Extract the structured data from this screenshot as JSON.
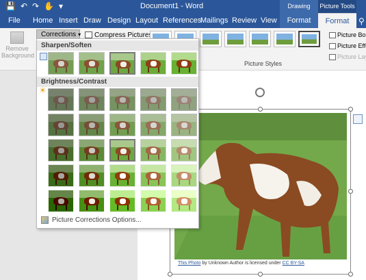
{
  "window": {
    "title": "Document1 - Word",
    "contextual_groups": [
      "Drawing Tools",
      "Picture Tools"
    ]
  },
  "tabs": [
    "File",
    "Home",
    "Insert",
    "Draw",
    "Design",
    "Layout",
    "References",
    "Mailings",
    "Review",
    "View",
    "Format",
    "Format"
  ],
  "ribbon": {
    "remove_background": "Remove Background",
    "corrections_label": "Corrections",
    "compress_label": "Compress Pictures",
    "picture_styles_label": "Picture Styles",
    "right_commands": [
      "Picture Bord",
      "Picture Effe",
      "Picture Layo"
    ]
  },
  "dropdown": {
    "section1_title": "Sharpen/Soften",
    "section2_title": "Brightness/Contrast",
    "options_link": "Picture Corrections Options...",
    "sharpen_selected_index": 2,
    "brightness_selected": [
      2,
      2
    ]
  },
  "document": {
    "caption_link1": "This Photo",
    "caption_mid": " by Unknown Author is licensed under ",
    "caption_link2": "CC BY-SA"
  },
  "colors": {
    "accent": "#2b579a",
    "ribbon_bg": "#f3f3f3"
  }
}
